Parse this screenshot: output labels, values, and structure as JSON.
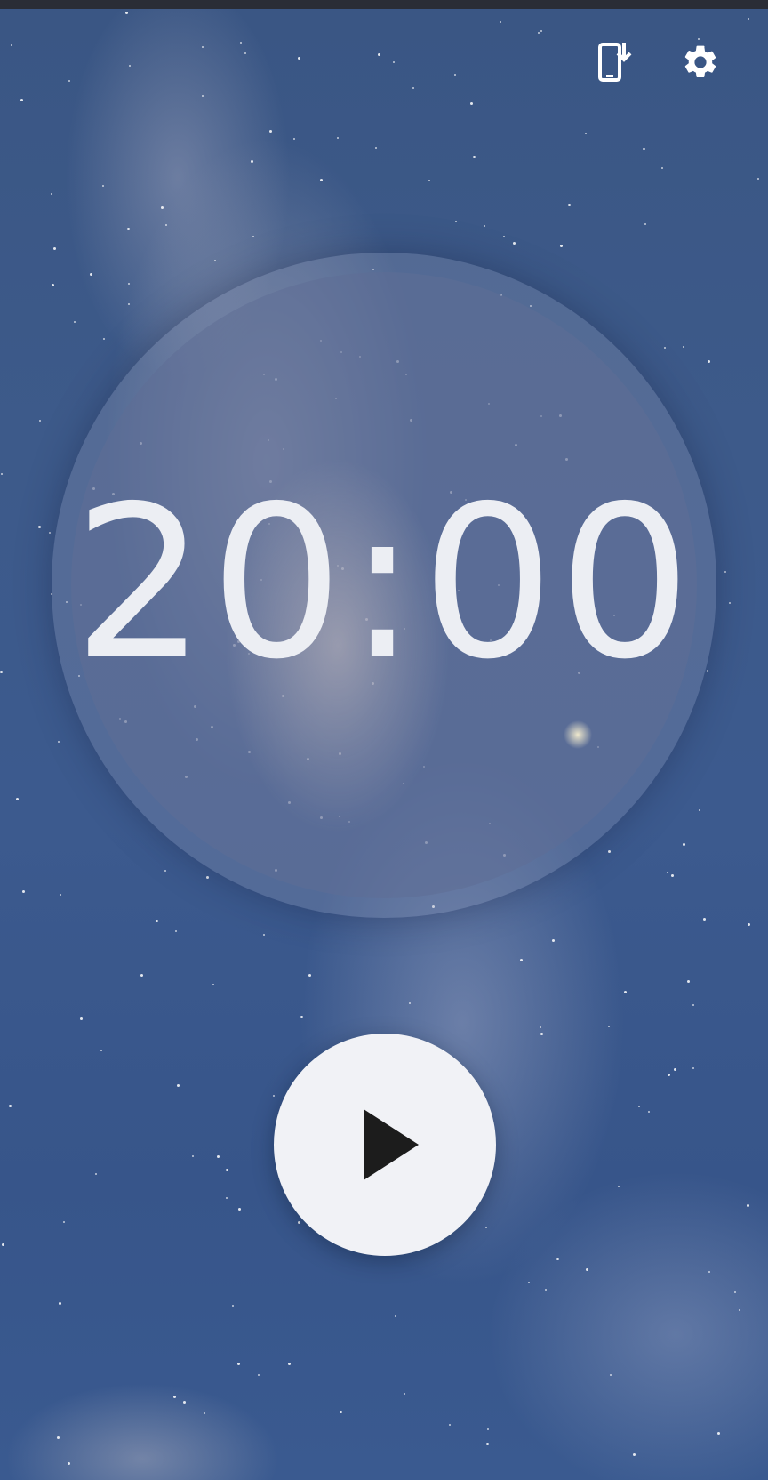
{
  "timer": {
    "display": "20:00"
  },
  "icons": {
    "save_to_device": "save-to-device-icon",
    "settings": "gear-icon",
    "play": "play-icon"
  },
  "colors": {
    "sky_background": "#3d5a8a",
    "timer_text": "#eceef3",
    "play_button_bg": "#f1f2f6",
    "play_glyph": "#1c1c1c"
  }
}
